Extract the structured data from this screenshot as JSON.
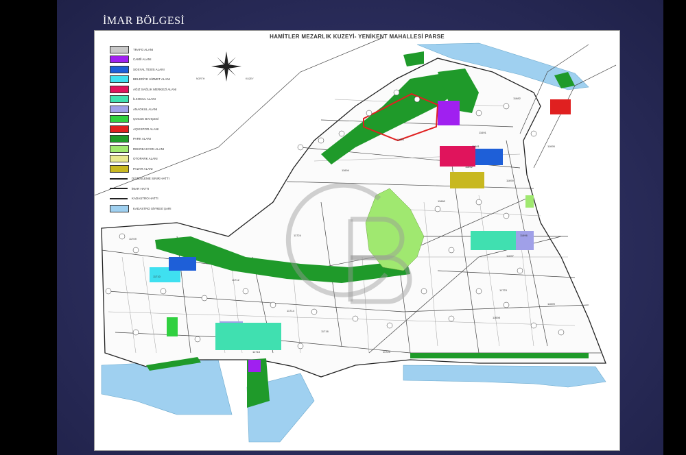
{
  "slide": {
    "title": "İMAR BÖLGESİ"
  },
  "map": {
    "title": "HAMİTLER MEZARLIK KUZEYİ- YENİKENT MAHALLESİ PARSE",
    "compass_labels": [
      "NORTH",
      "KUZEY"
    ],
    "legend": [
      {
        "label": "TRAFO ALANI",
        "color": "#c8c8c8",
        "kind": "fill"
      },
      {
        "label": "CAMİİ ALANI",
        "color": "#a020f0",
        "kind": "fill"
      },
      {
        "label": "SOSYAL TESİS ALANI",
        "color": "#1e5fd8",
        "kind": "fill"
      },
      {
        "label": "BELEDİYE HİZMET ALANI",
        "color": "#3fe0f0",
        "kind": "fill"
      },
      {
        "label": "AĞIZ SAĞLIK MERKEZİ ALANI",
        "color": "#e0145c",
        "kind": "fill"
      },
      {
        "label": "İLKOKUL ALANI",
        "color": "#40e0b0",
        "kind": "fill"
      },
      {
        "label": "ANAOKUL ALANI",
        "color": "#a0a0e8",
        "kind": "fill"
      },
      {
        "label": "ÇOCUK BAHÇESİ",
        "color": "#30d040",
        "kind": "fill"
      },
      {
        "label": "AÇIKSPOR ALANI",
        "color": "#e02020",
        "kind": "fill"
      },
      {
        "label": "PARK ALANI",
        "color": "#1f9a2a",
        "kind": "fill"
      },
      {
        "label": "REKREASYON ALANI",
        "color": "#a0e870",
        "kind": "fill"
      },
      {
        "label": "OTOPARK ALANI",
        "color": "#e8e890",
        "kind": "fill"
      },
      {
        "label": "PAZAR ALANI",
        "color": "#c8b820",
        "kind": "fill"
      },
      {
        "label": "DÜZENLEME SINIR HATTI",
        "color": "#222222",
        "kind": "line"
      },
      {
        "label": "İMAR HATTI",
        "color": "#222222",
        "kind": "line"
      },
      {
        "label": "KADASTRO HATTI",
        "color": "#222222",
        "kind": "line"
      },
      {
        "label": "KADASTRO SİYRESİ ŞARI",
        "color": "#9fd0f0",
        "kind": "fill"
      }
    ],
    "block_labels": [
      "11709",
      "11710",
      "11712",
      "11714",
      "11716",
      "11718",
      "11720",
      "11723",
      "11724",
      "11690",
      "11691",
      "11692",
      "11693",
      "11694",
      "11695",
      "11696",
      "11697",
      "11698",
      "11699",
      "11680",
      "11681",
      "11682"
    ]
  }
}
